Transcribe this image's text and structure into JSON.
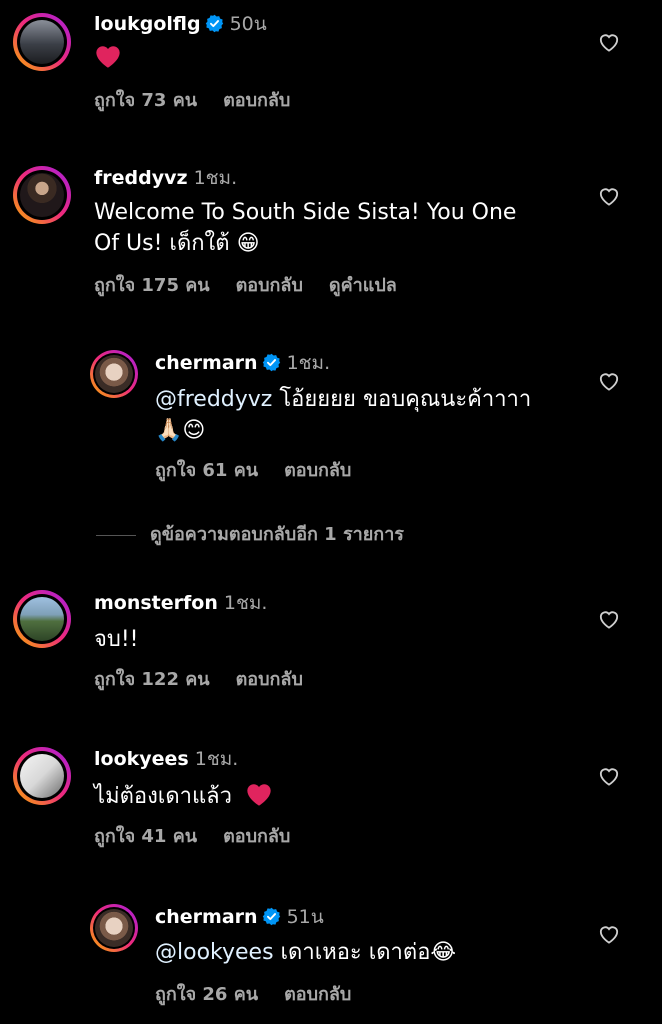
{
  "comments": [
    {
      "username": "loukgolflg",
      "time": "50น",
      "text": "",
      "like_count": "ถูกใจ 73 คน",
      "reply": "ตอบกลับ"
    },
    {
      "username": "freddyvz",
      "time": "1ชม.",
      "text_line1": "Welcome To South Side Sista! You One",
      "text_line2": "Of Us! เด็กใต้",
      "like_count": "ถูกใจ 175 คน",
      "reply": "ตอบกลับ",
      "translate": "ดูคำแปล"
    },
    {
      "username": "chermarn",
      "time": "1ชม.",
      "mention": "@freddyvz",
      "text_line1": " โอ้ยยยย ขอบคุณนะค้าาาา",
      "like_count": "ถูกใจ 61 คน",
      "reply": "ตอบกลับ"
    },
    {
      "username": "monsterfon",
      "time": "1ชม.",
      "text": "จบ!!",
      "like_count": "ถูกใจ 122 คน",
      "reply": "ตอบกลับ"
    },
    {
      "username": "lookyees",
      "time": "1ชม.",
      "text": "ไม่ต้องเดาแล้ว",
      "like_count": "ถูกใจ 41 คน",
      "reply": "ตอบกลับ"
    },
    {
      "username": "chermarn",
      "time": "51น",
      "mention": "@lookyees",
      "text": " เดาเหอะ เดาต่อ",
      "like_count": "ถูกใจ 26 คน",
      "reply": "ตอบกลับ"
    }
  ],
  "view_more_replies": "ดูข้อความตอบกลับอีก 1 รายการ",
  "colors": {
    "background": "#000000",
    "text": "#ffffff",
    "secondary": "#a8a8a8",
    "verified": "#0095f6",
    "heart_emoji": "#e0245e",
    "mention": "#e0f1ff"
  }
}
